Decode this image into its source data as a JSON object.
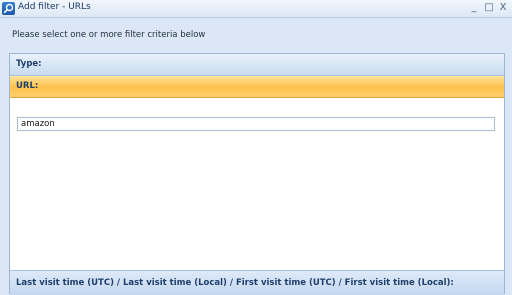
{
  "window": {
    "title": "Add filter - URLs",
    "minimize": "_",
    "maximize": "□",
    "close": "X"
  },
  "instructions": "Please select one or more filter criteria below",
  "sections": {
    "type_label": "Type:",
    "url_label": "URL:",
    "time_label": "Last visit time (UTC) / Last visit time (Local) / First visit time (UTC) / First visit time (Local):"
  },
  "url_filter": {
    "value": "amazon"
  },
  "colors": {
    "active_section": "#ffc04a",
    "section_header": "#c9dbf1",
    "background": "#dbe7f6"
  }
}
